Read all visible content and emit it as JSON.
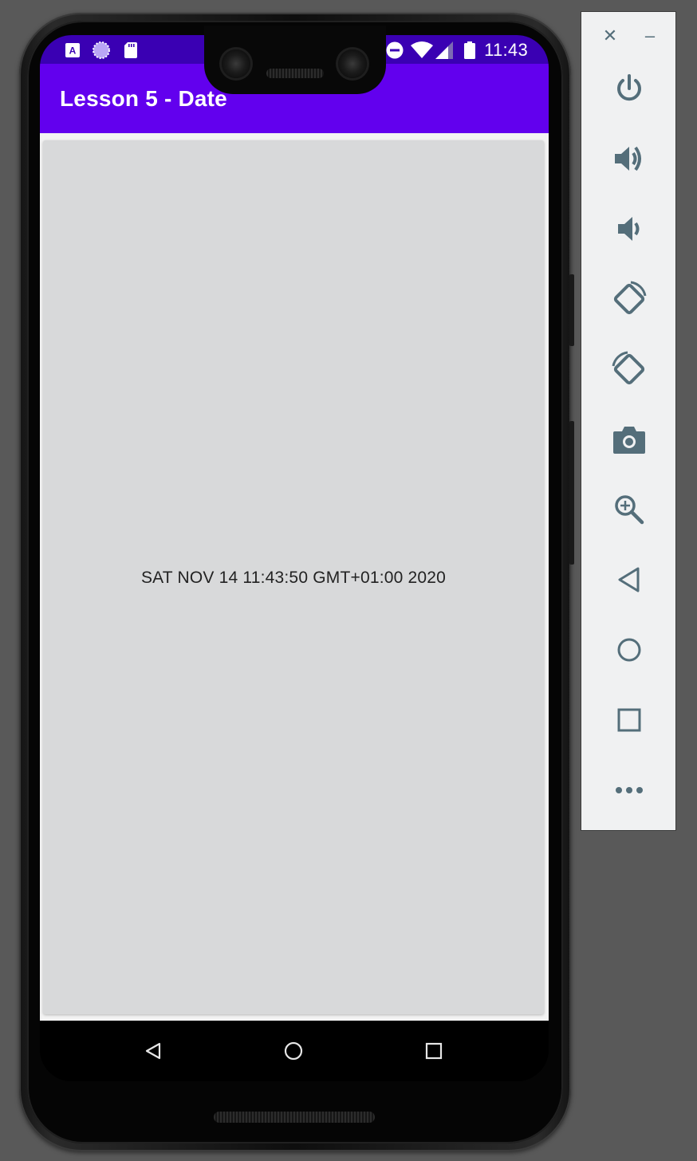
{
  "app": {
    "title": "Lesson 5 - Date",
    "date_text": "SAT NOV 14 11:43:50 GMT+01:00 2020"
  },
  "status_bar": {
    "time": "11:43",
    "icons_left": [
      "text-a-icon",
      "loading-circle-icon",
      "sd-card-icon"
    ],
    "icons_right": [
      "do-not-disturb-icon",
      "wifi-icon",
      "cell-signal-icon",
      "battery-icon"
    ]
  },
  "nav_bar": {
    "buttons": [
      "back-icon",
      "home-icon",
      "recents-icon"
    ]
  },
  "emulator_panel": {
    "window_controls": {
      "close_label": "✕",
      "minimize_label": "–"
    },
    "tools": [
      "power",
      "volume-up",
      "volume-down",
      "rotate-left",
      "rotate-right",
      "screenshot",
      "zoom",
      "back",
      "home",
      "overview",
      "more"
    ]
  },
  "colors": {
    "status_bar": "#3a00b3",
    "app_bar": "#6200ee",
    "card": "#d8d9da",
    "panel_icon": "#546e7a",
    "background": "#595959"
  }
}
